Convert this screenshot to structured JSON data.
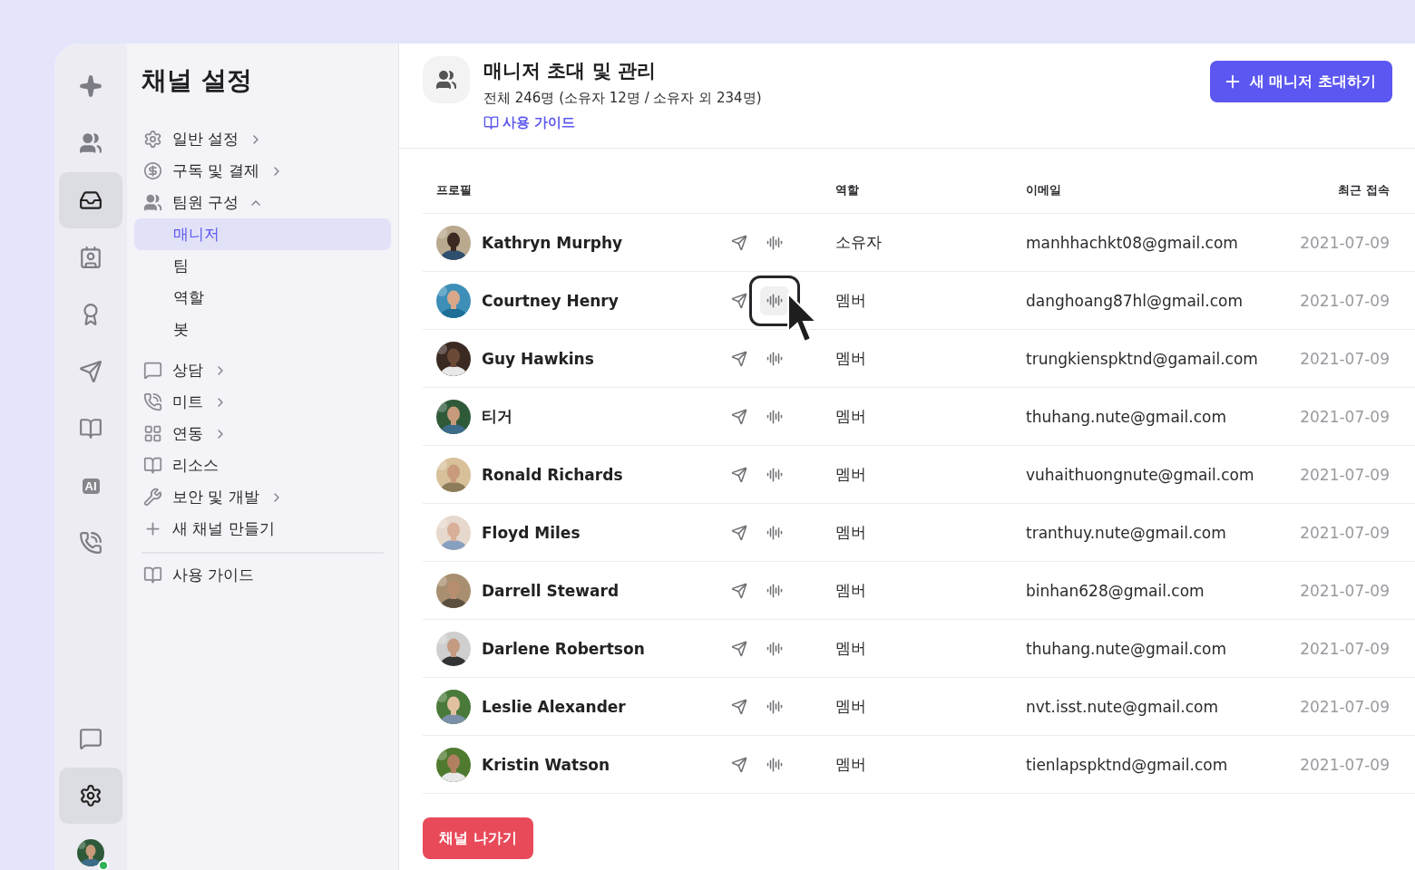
{
  "rail": {
    "items": [
      {
        "selected": false
      },
      {
        "selected": false
      },
      {
        "selected": true
      },
      {
        "selected": false
      },
      {
        "selected": false
      },
      {
        "selected": false
      },
      {
        "selected": false
      },
      {
        "label": "AI",
        "selected": false
      },
      {
        "selected": false
      }
    ],
    "bottom": [
      {
        "selected": false
      },
      {
        "selected": true
      }
    ],
    "user": {
      "online": true
    }
  },
  "sidebar": {
    "title": "채널 설정",
    "items": [
      {
        "label": "일반 설정",
        "expanded": false
      },
      {
        "label": "구독 및 결제",
        "expanded": false
      },
      {
        "label": "팀원 구성",
        "expanded": true,
        "children": [
          {
            "label": "매니저",
            "selected": true
          },
          {
            "label": "팀",
            "selected": false
          },
          {
            "label": "역할",
            "selected": false
          },
          {
            "label": "봇",
            "selected": false
          }
        ]
      },
      {
        "label": "상담",
        "expanded": false
      },
      {
        "label": "미트",
        "expanded": false
      },
      {
        "label": "연동",
        "expanded": false
      },
      {
        "label": "리소스"
      },
      {
        "label": "보안 및 개발",
        "expanded": false
      },
      {
        "label": "새 채널 만들기"
      }
    ],
    "footer": {
      "label": "사용 가이드"
    }
  },
  "header": {
    "title": "매니저 초대 및 관리",
    "subtitle": "전체 246명 (소유자 12명 / 소유자 외 234명)",
    "guide_link": "사용 가이드",
    "invite_button": "새 매니저 초대하기"
  },
  "table": {
    "columns": [
      "프로필",
      "역할",
      "이메일",
      "최근 접속"
    ],
    "rows": [
      {
        "name": "Kathryn Murphy",
        "role": "소유자",
        "email": "manhhachkt08@gmail.com",
        "last_access": "2021-07-09",
        "voice_focused": false
      },
      {
        "name": "Courtney Henry",
        "role": "멤버",
        "email": "danghoang87hl@gmail.com",
        "last_access": "2021-07-09",
        "voice_focused": true
      },
      {
        "name": "Guy Hawkins",
        "role": "멤버",
        "email": "trungkienspktnd@gamail.com",
        "last_access": "2021-07-09",
        "voice_focused": false
      },
      {
        "name": "티거",
        "role": "멤버",
        "email": "thuhang.nute@gmail.com",
        "last_access": "2021-07-09",
        "voice_focused": false
      },
      {
        "name": "Ronald Richards",
        "role": "멤버",
        "email": "vuhaithuongnute@gmail.com",
        "last_access": "2021-07-09",
        "voice_focused": false
      },
      {
        "name": "Floyd Miles",
        "role": "멤버",
        "email": "tranthuy.nute@gmail.com",
        "last_access": "2021-07-09",
        "voice_focused": false
      },
      {
        "name": "Darrell Steward",
        "role": "멤버",
        "email": "binhan628@gmail.com",
        "last_access": "2021-07-09",
        "voice_focused": false
      },
      {
        "name": "Darlene Robertson",
        "role": "멤버",
        "email": "thuhang.nute@gmail.com",
        "last_access": "2021-07-09",
        "voice_focused": false
      },
      {
        "name": "Leslie Alexander",
        "role": "멤버",
        "email": "nvt.isst.nute@gmail.com",
        "last_access": "2021-07-09",
        "voice_focused": false
      },
      {
        "name": "Kristin Watson",
        "role": "멤버",
        "email": "tienlapspktnd@gmail.com",
        "last_access": "2021-07-09",
        "voice_focused": false
      }
    ]
  },
  "leave_button": "채널 나가기"
}
